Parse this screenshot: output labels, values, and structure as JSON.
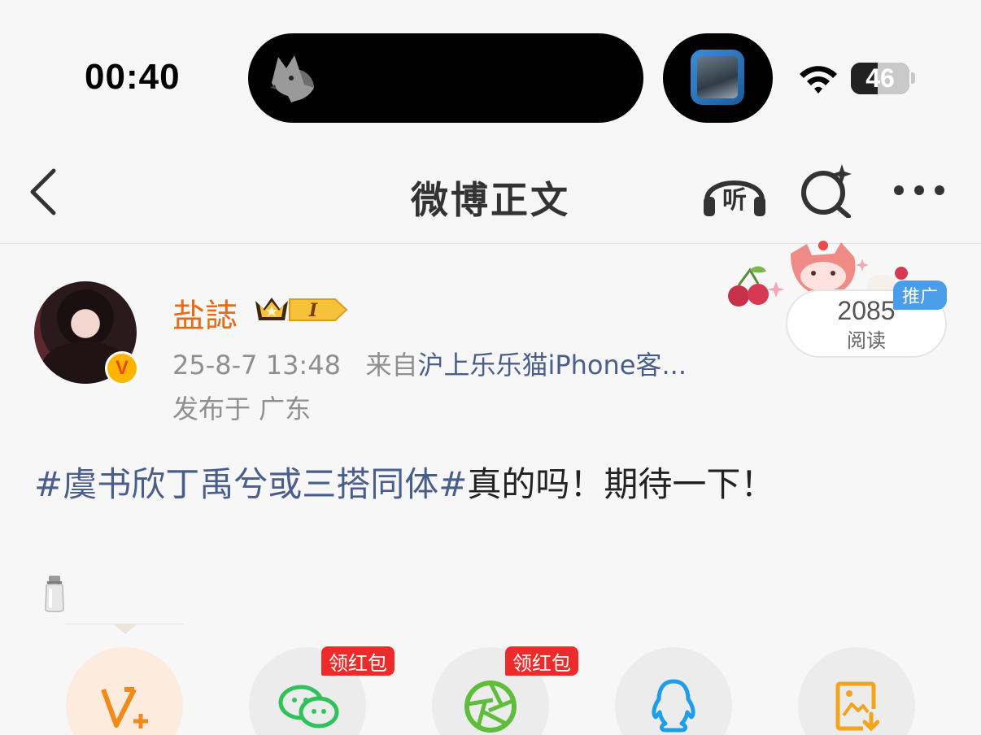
{
  "status_bar": {
    "time": "00:40",
    "battery": "46",
    "battery_level": 0.46
  },
  "nav": {
    "title": "微博正文",
    "listen_label": "听"
  },
  "post": {
    "username": "盐誌",
    "member_level": "I",
    "date": "25-8-7 13:48",
    "source_prefix": "来自",
    "source": "沪上乐乐猫iPhone客...",
    "location": "发布于 广东",
    "read_count": "2085",
    "read_label": "阅读",
    "promo_tag": "推广",
    "hashtag": "#虞书欣丁禹兮或三搭同体#",
    "text": "真的吗！期待一下！"
  },
  "share": {
    "red_packet_label_1": "领红包",
    "red_packet_label_2": "领红包"
  },
  "colors": {
    "accent_orange": "#e86a15",
    "link_blue": "#4a5e8c",
    "promo_blue": "#4a9de8",
    "red_tag": "#ee2b2b",
    "wechat_green": "#2fc25b",
    "qq_blue": "#1e9ee8",
    "save_orange": "#f5a31a"
  }
}
